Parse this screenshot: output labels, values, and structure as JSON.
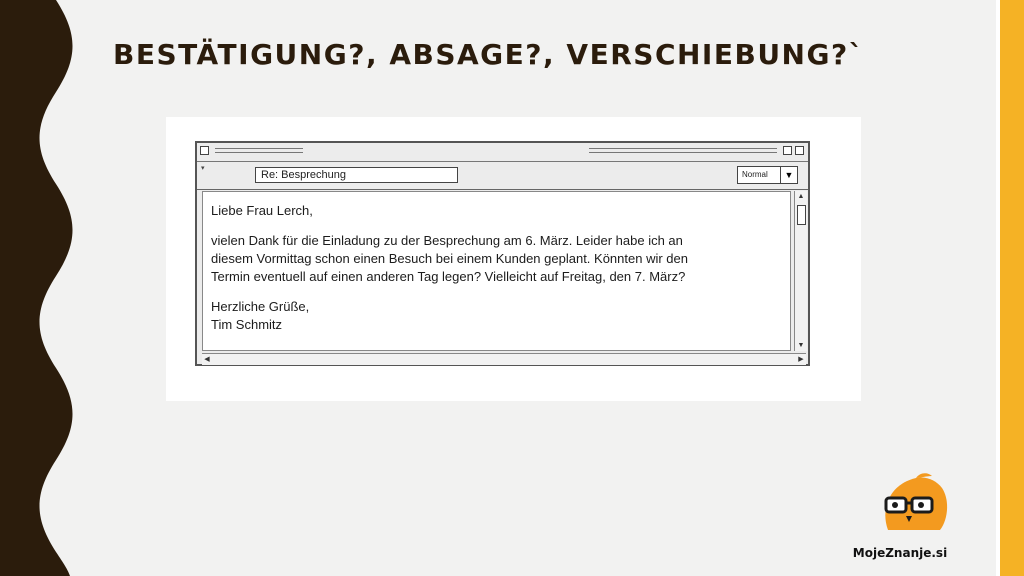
{
  "slide": {
    "title": "BESTÄTIGUNG?, ABSAGE?, VERSCHIEBUNG?`"
  },
  "email": {
    "subject": "Re: Besprechung",
    "style_select": "Normal",
    "greeting": "Liebe Frau Lerch,",
    "body_lines": [
      "vielen Dank für die Einladung zu der Besprechung am 6. März. Leider habe ich an",
      "diesem Vormittag schon einen Besuch bei einem Kunden geplant. Könnten wir den",
      "Termin eventuell auf einen anderen Tag legen? Vielleicht auf Freitag, den 7. März?"
    ],
    "closing": "Herzliche Grüße,",
    "signature": "Tim Schmitz"
  },
  "brand": {
    "name": "MojeZnanje.si"
  },
  "colors": {
    "background": "#f2f2f1",
    "left_band": "#2b1c0c",
    "right_band": "#f5b225",
    "logo_orange": "#f39a1f"
  },
  "icons": {
    "left": "wavy-band",
    "logo": "glasses-mascot-icon"
  }
}
